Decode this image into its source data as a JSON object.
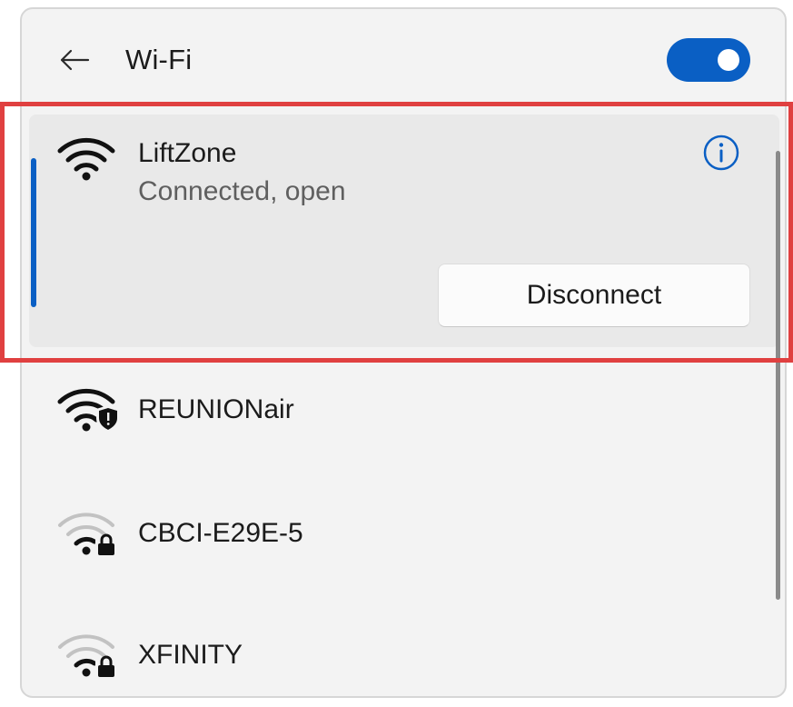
{
  "header": {
    "title": "Wi-Fi",
    "wifi_enabled": true,
    "back_icon": "arrow-left-icon"
  },
  "connected_network": {
    "name": "LiftZone",
    "status": "Connected, open",
    "disconnect_label": "Disconnect",
    "signal_icon": "wifi-full-signal-icon",
    "info_icon": "info-icon"
  },
  "networks": [
    {
      "name": "REUNIONair",
      "signal": "full",
      "icon": "wifi-secured-shield-icon"
    },
    {
      "name": "CBCI-E29E-5",
      "signal": "weak",
      "icon": "wifi-locked-icon"
    },
    {
      "name": "XFINITY",
      "signal": "weak",
      "icon": "wifi-locked-icon"
    }
  ],
  "colors": {
    "accent": "#0a5fc4",
    "highlight": "#e04040",
    "panel_bg": "#f3f3f3"
  }
}
